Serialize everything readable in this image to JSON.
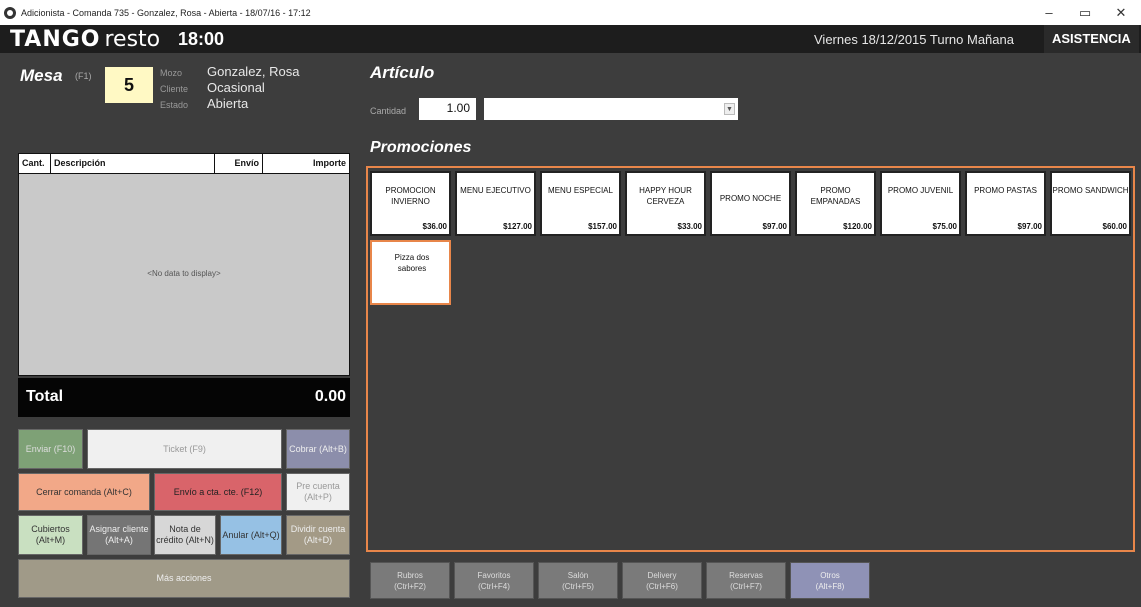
{
  "window": {
    "title": "Adicionista - Comanda 735 - Gonzalez, Rosa - Abierta - 18/07/16 - 17:12",
    "controls": [
      "–",
      "▭",
      "✕"
    ]
  },
  "header": {
    "logo_main": "TANGO",
    "logo_sub": "resto",
    "time": "18:00",
    "date_shift": "Viernes 18/12/2015 Turno Mañana",
    "asistencia": "ASISTENCIA"
  },
  "mesa": {
    "label": "Mesa",
    "shortcut": "(F1)",
    "number": "5",
    "mozo_label": "Mozo",
    "mozo": "Gonzalez, Rosa",
    "cliente_label": "Cliente",
    "cliente": "Ocasional",
    "estado_label": "Estado",
    "estado": "Abierta"
  },
  "order_table": {
    "columns": [
      "Cant.",
      "Descripción",
      "Envío",
      "Importe"
    ],
    "empty_text": "<No data to display>",
    "total_label": "Total",
    "total_value": "0.00"
  },
  "actions": {
    "enviar": "Enviar (F10)",
    "ticket": "Ticket (F9)",
    "cobrar": "Cobrar (Alt+B)",
    "cerrar": "Cerrar comanda (Alt+C)",
    "envio_cta": "Envío a cta. cte. (F12)",
    "precuenta": "Pre cuenta (Alt+P)",
    "cubiertos": "Cubiertos (Alt+M)",
    "asignar": "Asignar cliente (Alt+A)",
    "nota": "Nota de crédito (Alt+N)",
    "anular": "Anular (Alt+Q)",
    "dividir": "Dividir cuenta (Alt+D)",
    "mas": "Más acciones"
  },
  "articulo": {
    "label": "Artículo",
    "cantidad_label": "Cantidad",
    "cantidad": "1.00",
    "selected": ""
  },
  "promociones": {
    "label": "Promociones",
    "items": [
      {
        "name": "PROMOCION INVIERNO",
        "price": "$36.00"
      },
      {
        "name": "MENU EJECUTIVO",
        "price": "$127.00"
      },
      {
        "name": "MENU ESPECIAL",
        "price": "$157.00"
      },
      {
        "name": "HAPPY HOUR CERVEZA",
        "price": "$33.00"
      },
      {
        "name": "PROMO NOCHE",
        "price": "$97.00"
      },
      {
        "name": "PROMO EMPANADAS",
        "price": "$120.00"
      },
      {
        "name": "PROMO JUVENIL",
        "price": "$75.00"
      },
      {
        "name": "PROMO PASTAS",
        "price": "$97.00"
      },
      {
        "name": "PROMO SANDWICH",
        "price": "$60.00"
      },
      {
        "name": "Pizza dos sabores",
        "price": ""
      }
    ]
  },
  "bottom_tabs": [
    {
      "label": "Rubros",
      "key": "(Ctrl+F2)"
    },
    {
      "label": "Favoritos",
      "key": "(Ctrl+F4)"
    },
    {
      "label": "Salón",
      "key": "(Ctrl+F5)"
    },
    {
      "label": "Delivery",
      "key": "(Ctrl+F6)"
    },
    {
      "label": "Reservas",
      "key": "(Ctrl+F7)"
    },
    {
      "label": "Otros",
      "key": "(Alt+F8)"
    }
  ]
}
